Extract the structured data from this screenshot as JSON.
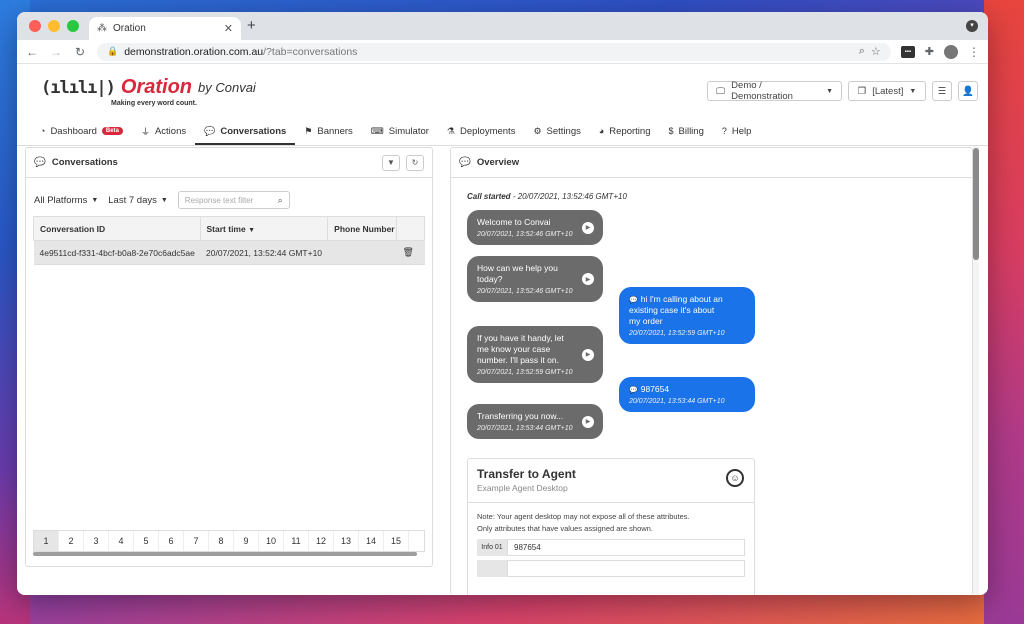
{
  "browser": {
    "tab_title": "Oration",
    "url_host": "demonstration.oration.com.au",
    "url_path": "/?tab=conversations"
  },
  "header": {
    "brand": "Oration",
    "by": "by Convai",
    "tagline": "Making every word count.",
    "org_selector": "Demo / Demonstration",
    "version_selector": "[Latest]"
  },
  "nav": {
    "items": [
      {
        "label": "Dashboard",
        "badge": "Beta"
      },
      {
        "label": "Actions"
      },
      {
        "label": "Conversations"
      },
      {
        "label": "Banners"
      },
      {
        "label": "Simulator"
      },
      {
        "label": "Deployments"
      },
      {
        "label": "Settings"
      },
      {
        "label": "Reporting"
      },
      {
        "label": "Billing"
      },
      {
        "label": "Help"
      }
    ]
  },
  "conversations": {
    "title": "Conversations",
    "platform_filter": "All Platforms",
    "date_filter": "Last 7 days",
    "search_placeholder": "Response text filter",
    "columns": [
      "Conversation ID",
      "Start time",
      "Phone Number"
    ],
    "rows": [
      {
        "id": "4e9511cd-f331-4bcf-b0a8-2e70c6adc5ae",
        "start": "20/07/2021, 13:52:44 GMT+10",
        "phone": ""
      }
    ],
    "pages": [
      "1",
      "2",
      "3",
      "4",
      "5",
      "6",
      "7",
      "8",
      "9",
      "10",
      "11",
      "12",
      "13",
      "14",
      "15"
    ]
  },
  "overview": {
    "title": "Overview",
    "call_started_label": "Call started",
    "call_started_time": "- 20/07/2021, 13:52:46 GMT+10",
    "messages": [
      {
        "text": "Welcome to Convai",
        "time": "20/07/2021, 13:52:46 GMT+10"
      },
      {
        "text": "How can we help you today?",
        "time": "20/07/2021, 13:52:46 GMT+10"
      },
      {
        "text": "hi I'm calling about an existing case it's about my order",
        "time": "20/07/2021, 13:52:59 GMT+10"
      },
      {
        "text": "If you have it handy, let me know your case number. I'll pass it on.",
        "time": "20/07/2021, 13:52:59 GMT+10"
      },
      {
        "text": "987654",
        "time": "20/07/2021, 13:53:44 GMT+10"
      },
      {
        "text": "Transferring you now...",
        "time": "20/07/2021, 13:53:44 GMT+10"
      }
    ],
    "transfer": {
      "title": "Transfer to Agent",
      "subtitle": "Example Agent Desktop",
      "note1": "Note: Your agent desktop may not expose all of these attributes.",
      "note2": "Only attributes that have values assigned are shown.",
      "attr_key": "Info 01",
      "attr_value": "987654"
    }
  }
}
